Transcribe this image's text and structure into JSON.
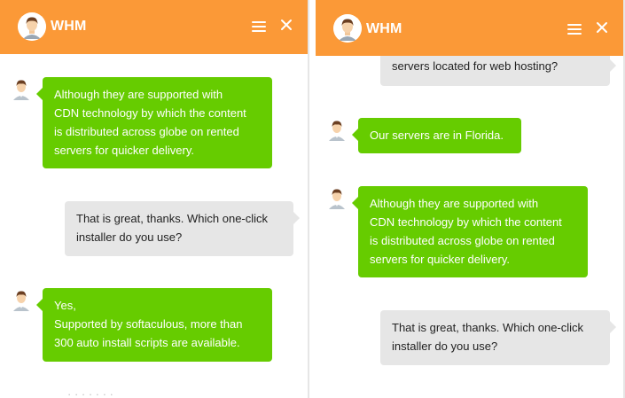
{
  "widget": {
    "title": "WHM",
    "menu_icon": "hamburger-icon",
    "close_icon": "close-icon",
    "brand_color": "#fb9937",
    "agent_bubble_color": "#66cc00",
    "user_bubble_color": "#e6e6e6"
  },
  "left": {
    "messages": [
      {
        "from": "agent",
        "lines": [
          "Although they are supported with",
          "CDN technology by which the content",
          "is distributed across globe on rented",
          "servers for quicker delivery."
        ]
      },
      {
        "from": "user",
        "lines": [
          "That is great, thanks. Which one-click",
          "installer do you use?"
        ]
      },
      {
        "from": "agent",
        "lines": [
          "Yes,",
          "Supported by softaculous, more than",
          "300 auto install scripts are available."
        ]
      }
    ],
    "faded_text": "  ·  ·   ·  ·      ·  ·  ·"
  },
  "right": {
    "messages": [
      {
        "from": "user",
        "lines": [
          "servers located for web hosting?"
        ]
      },
      {
        "from": "agent",
        "lines": [
          "Our servers are in Florida."
        ]
      },
      {
        "from": "agent",
        "lines": [
          "Although they are supported with",
          "CDN technology by which the content",
          "is distributed across globe on rented",
          "servers for quicker delivery."
        ]
      },
      {
        "from": "user",
        "lines": [
          "That is great, thanks. Which one-click",
          "installer do you use?"
        ]
      }
    ]
  }
}
